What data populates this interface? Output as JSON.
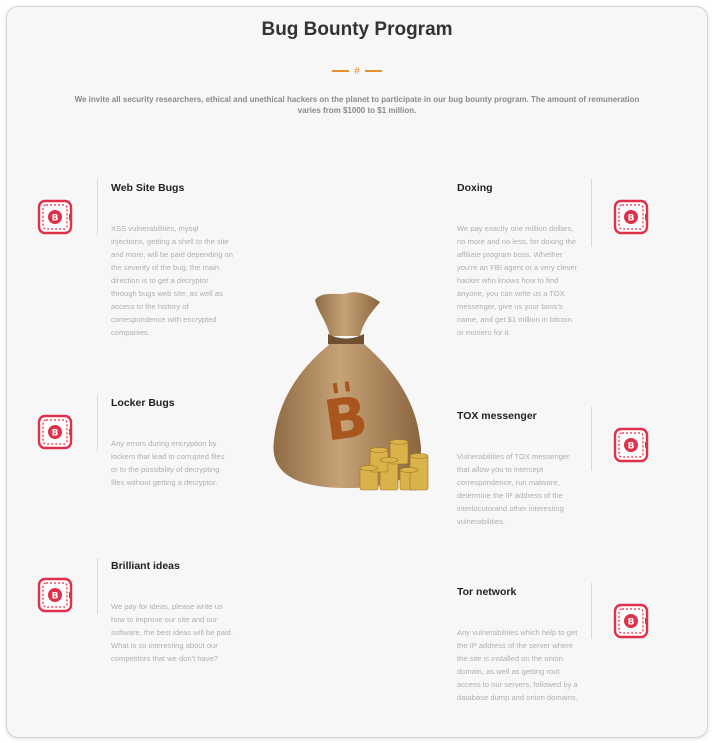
{
  "header": {
    "title": "Bug Bounty Program",
    "divider_glyph": "#",
    "intro": "We invite all security researchers, ethical and unethical hackers on the planet to participate in our bug bounty program. The amount of remuneration varies from $1000 to $1 million."
  },
  "left_items": [
    {
      "title": "Web Site Bugs",
      "description": "XSS vulnerabilities, mysql injections, getting a shell to the site and more, will be paid depending on the severity of the bug, the main direction is to get a decryptor through bugs web site, as well as access to the history of correspondence with encrypted companies."
    },
    {
      "title": "Locker Bugs",
      "description": "Any errors during encryption by lockers that lead to corrupted files or to the possibility of decrypting files without getting a decryptor."
    },
    {
      "title": "Brilliant ideas",
      "description": "We pay for ideas, please write us how to improve our site and our software, the best ideas will be paid. What is so interesting about our competitors that we don't have?"
    }
  ],
  "right_items": [
    {
      "title": "Doxing",
      "description": "We pay exactly one million dollars, no more and no less, for doxing the affiliate program boss. Whether you're an FBI agent or a very clever hacker who knows how to find anyone, you can write us a TOX messenger, give us your boss's name, and get $1 million in bitcoin or monero for it."
    },
    {
      "title": "TOX messenger",
      "description": "Vulnerabilities of TOX messenger that allow you to intercept correspondence, run malware, determine the IP address of the interlocutorand other interesting vulnerabilities."
    },
    {
      "title": "Tor network",
      "description": "Any vulnerabilities which help to get the IP address of the server where the site is installed on the onion domain, as well as getting root access to our servers, followed by a database dump and onion domains."
    }
  ],
  "icon": {
    "name": "bitcoin-wallet-icon",
    "color": "#e0304a"
  },
  "illustration": {
    "name": "bitcoin-money-bag",
    "bag_color": "#b08a5c",
    "symbol_color": "#a8551e",
    "coin_color": "#d9b24a"
  }
}
